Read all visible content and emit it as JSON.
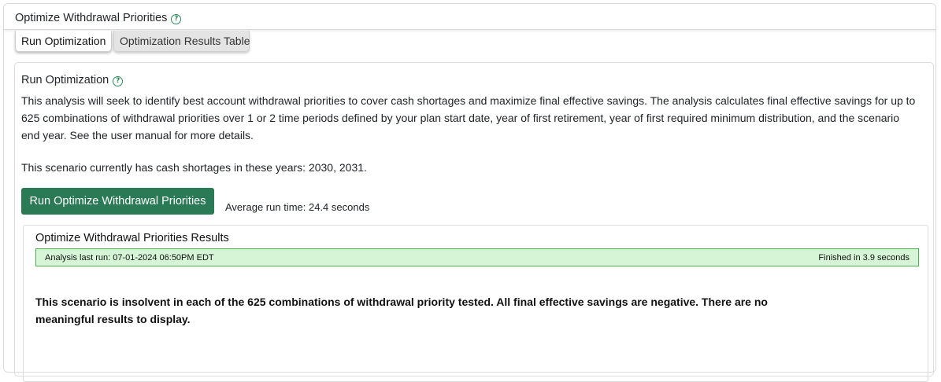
{
  "header": {
    "title": "Optimize Withdrawal Priorities",
    "help_glyph": "?"
  },
  "tabs": [
    {
      "label": "Run Optimization",
      "active": true
    },
    {
      "label": "Optimization Results Table",
      "active": false
    }
  ],
  "panel": {
    "title": "Run Optimization",
    "help_glyph": "?",
    "description": "This analysis will seek to identify best account withdrawal priorities to cover cash shortages and maximize final effective savings. The analysis calculates final effective savings for up to 625 combinations of withdrawal priorities over 1 or 2 time periods defined by your plan start date, year of first retirement, year of first required minimum distribution, and the scenario end year. See the user manual for more details.",
    "shortage_text": "This scenario currently has cash shortages in these years: 2030, 2031.",
    "run_button_label": "Run Optimize Withdrawal Priorities",
    "avg_run_time": "Average run time: 24.4 seconds"
  },
  "results": {
    "title": "Optimize Withdrawal Priorities Results",
    "last_run": "Analysis last run: 07-01-2024 06:50PM EDT",
    "finished": "Finished in 3.9 seconds",
    "message": "This scenario is insolvent in each of the 625 combinations of withdrawal priority tested. All final effective savings are negative. There are no meaningful results to display."
  },
  "colors": {
    "accent_button": "#2a7a55",
    "help_icon": "#2e8b57",
    "status_bg": "#d6f5d6",
    "status_border": "#4caf50"
  },
  "icons": {
    "help": "help-circle-icon"
  }
}
